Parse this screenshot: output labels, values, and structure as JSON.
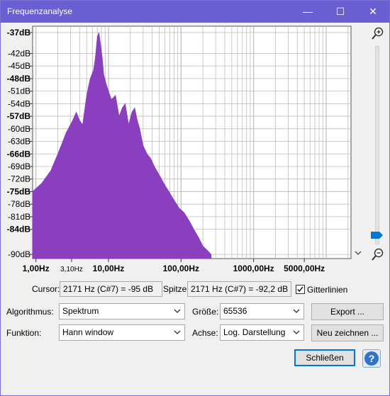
{
  "window": {
    "title": "Frequenzanalyse",
    "minimize_glyph": "—",
    "maximize_glyph": "☐",
    "close_glyph": "✕"
  },
  "colors": {
    "titlebar": "#6a5fd2",
    "spectrum_fill": "#8a3fbf",
    "grid": "#bdbdbd",
    "plot_bg": "#ffffff",
    "accent": "#0078d7"
  },
  "icons": {
    "zoom_in": "zoom-in-icon",
    "zoom_out": "zoom-out-icon",
    "dropdown": "chevron-down-icon",
    "slider_thumb": "slider-thumb-icon",
    "help": "help-icon",
    "check": "checkmark-icon"
  },
  "chart_data": {
    "type": "area",
    "y_tick_labels": [
      "-37dB",
      "-42dB",
      "-45dB",
      "-48dB",
      "-51dB",
      "-54dB",
      "-57dB",
      "-60dB",
      "-63dB",
      "-66dB",
      "-69dB",
      "-72dB",
      "-75dB",
      "-78dB",
      "-81dB",
      "-84dB",
      "-90dB"
    ],
    "y_tick_values": [
      -37,
      -42,
      -45,
      -48,
      -51,
      -54,
      -57,
      -60,
      -63,
      -66,
      -69,
      -72,
      -75,
      -78,
      -81,
      -84,
      -90
    ],
    "x_tick_labels": [
      {
        "value": 1,
        "label": "1,00Hz"
      },
      {
        "value": 3.1,
        "label": "3,10Hz"
      },
      {
        "value": 10,
        "label": "10,00Hz"
      },
      {
        "value": 100,
        "label": "100,00Hz"
      },
      {
        "value": 1000,
        "label": "1000,00Hz"
      },
      {
        "value": 5000,
        "label": "5000,00Hz"
      }
    ],
    "x_scale": "log",
    "ylim": [
      -91,
      -35.5
    ],
    "xlim": [
      0.9,
      22000
    ],
    "grid": true,
    "series": [
      {
        "x": [
          0.9,
          1.2,
          1.6,
          2.0,
          2.6,
          3.2,
          3.6,
          4.0,
          4.4,
          5.0,
          5.6,
          6.2,
          6.6,
          7.0,
          7.4,
          7.8,
          8.2,
          8.6,
          9.2,
          10,
          11,
          12.5,
          14,
          15.5,
          17,
          19,
          21,
          23,
          25,
          27,
          30,
          34,
          38,
          43,
          50,
          58,
          68,
          80,
          95,
          110,
          130,
          150,
          175,
          200,
          230,
          260
        ],
        "y": [
          -75,
          -73,
          -70,
          -66,
          -61,
          -58,
          -56,
          -58,
          -59,
          -52,
          -48,
          -46,
          -43,
          -38,
          -37,
          -40,
          -43,
          -47,
          -49,
          -51,
          -53,
          -52,
          -57,
          -55,
          -54,
          -59,
          -56,
          -55,
          -58,
          -60,
          -64,
          -66,
          -67,
          -69,
          -71,
          -73,
          -75,
          -77,
          -79,
          -80,
          -82,
          -84,
          -86,
          -88,
          -89,
          -90
        ]
      }
    ]
  },
  "controls": {
    "cursor_label": "Cursor:",
    "cursor_value": "2171 Hz (C#7) = -95 dB",
    "peak_label": "Spitze:",
    "peak_value": "2171 Hz (C#7) = -92,2 dB",
    "gridlines_label": "Gitterlinien",
    "gridlines_checked": true,
    "algorithm_label": "Algorithmus:",
    "algorithm_value": "Spektrum",
    "size_label": "Größe:",
    "size_value": "65536",
    "export_button": "Export ...",
    "function_label": "Funktion:",
    "function_value": "Hann window",
    "axis_label": "Achse:",
    "axis_value": "Log. Darstellung",
    "redraw_button": "Neu zeichnen ...",
    "close_button": "Schließen",
    "help_glyph": "?"
  }
}
